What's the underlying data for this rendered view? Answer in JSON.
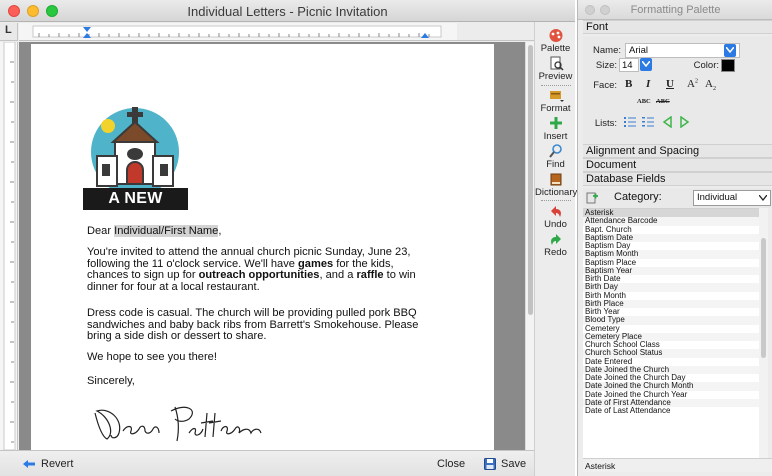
{
  "window": {
    "title": "Individual Letters - Picnic Invitation",
    "ruler_unit_glyph": "L"
  },
  "logo": {
    "text": "A NEW HOPE"
  },
  "letter": {
    "salutation_prefix": "Dear ",
    "merge_field": "Individual/First Name",
    "salutation_suffix": ",",
    "p1_a": "You're invited to attend the annual church picnic Sunday, June 23, following the 11 o'clock service. We'll have ",
    "p1_b": "games",
    "p1_c": " for the kids, chances to sign up for ",
    "p1_d": "outreach opportunities",
    "p1_e": ", and a ",
    "p1_f": "raffle",
    "p1_g": " to win dinner for four at a local restaurant.",
    "p2": "Dress code is casual. The church will be providing pulled pork BBQ sandwiches and baby back ribs from Barrett's Smokehouse. Please bring a side dish or dessert to share.",
    "p3": "We hope to see you there!",
    "closing": "Sincerely,",
    "signature": "Dean Patterson"
  },
  "bottom_bar": {
    "revert": "Revert",
    "close": "Close",
    "save": "Save"
  },
  "tools": {
    "palette": "Palette",
    "preview": "Preview",
    "format": "Format",
    "insert": "Insert",
    "find": "Find",
    "dictionary": "Dictionary",
    "undo": "Undo",
    "redo": "Redo"
  },
  "palette": {
    "title": "Formatting Palette",
    "font_header": "Font",
    "name_label": "Name:",
    "name_value": "Arial",
    "size_label": "Size:",
    "size_value": "14",
    "color_label": "Color:",
    "face_label": "Face:",
    "face_bold": "B",
    "face_italic": "I",
    "face_underline": "U",
    "face_super": "A",
    "face_sub": "A",
    "face_caps": "ABC",
    "face_strike": "ABC",
    "lists_label": "Lists:",
    "alignment_header": "Alignment and Spacing",
    "document_header": "Document",
    "database_header": "Database Fields",
    "category_label": "Category:",
    "category_value": "Individual",
    "fields": [
      "Asterisk",
      "Attendance Barcode",
      "Bapt. Church",
      "Baptism Date",
      "Baptism Day",
      "Baptism Month",
      "Baptism Place",
      "Baptism Year",
      "Birth Date",
      "Birth Day",
      "Birth Month",
      "Birth Place",
      "Birth Year",
      "Blood Type",
      "Cemetery",
      "Cemetery Place",
      "Church School Class",
      "Church School Status",
      "Date Entered",
      "Date Joined the Church",
      "Date Joined the Church Day",
      "Date Joined the Church Month",
      "Date Joined the Church Year",
      "Date of First Attendance",
      "Date of Last Attendance"
    ],
    "status_field": "Asterisk"
  },
  "colors": {
    "logo_circle": "#4fb3c9",
    "logo_banner": "#1a1a1a",
    "sun": "#f2d22c",
    "merge_highlight": "#d3d3d3",
    "accent_blue": "#2c7be5"
  }
}
